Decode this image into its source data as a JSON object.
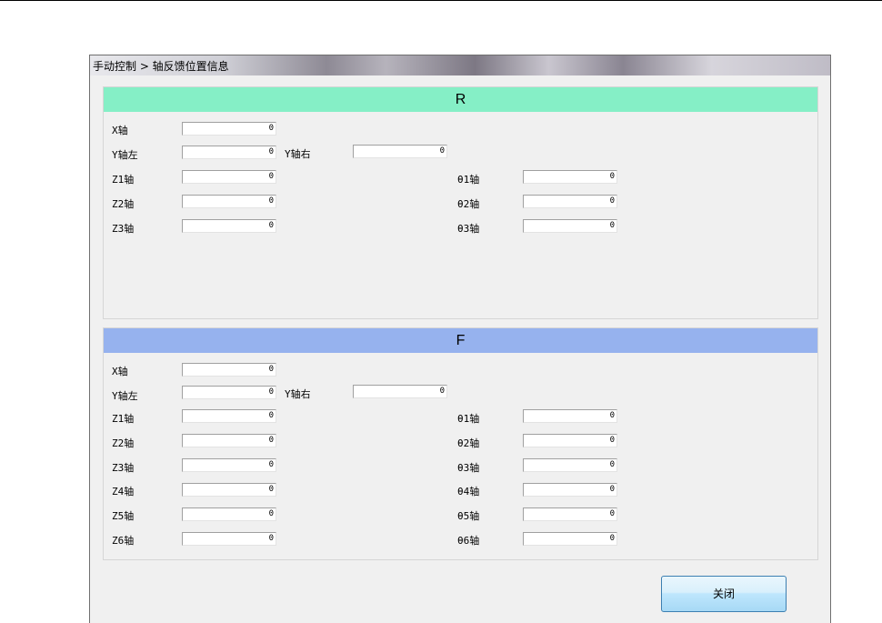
{
  "window": {
    "title": "手动控制 > 轴反馈位置信息"
  },
  "panel_r": {
    "header": "R",
    "x_label": "X轴",
    "x_value": "0",
    "y_left_label": "Y轴左",
    "y_left_value": "0",
    "y_right_label": "Y轴右",
    "y_right_value": "0",
    "rows": [
      {
        "z_label": "Z1轴",
        "z_value": "0",
        "t_label": "θ1轴",
        "t_value": "0"
      },
      {
        "z_label": "Z2轴",
        "z_value": "0",
        "t_label": "θ2轴",
        "t_value": "0"
      },
      {
        "z_label": "Z3轴",
        "z_value": "0",
        "t_label": "θ3轴",
        "t_value": "0"
      }
    ]
  },
  "panel_f": {
    "header": "F",
    "x_label": "X轴",
    "x_value": "0",
    "y_left_label": "Y轴左",
    "y_left_value": "0",
    "y_right_label": "Y轴右",
    "y_right_value": "0",
    "rows": [
      {
        "z_label": "Z1轴",
        "z_value": "0",
        "t_label": "θ1轴",
        "t_value": "0"
      },
      {
        "z_label": "Z2轴",
        "z_value": "0",
        "t_label": "θ2轴",
        "t_value": "0"
      },
      {
        "z_label": "Z3轴",
        "z_value": "0",
        "t_label": "θ3轴",
        "t_value": "0"
      },
      {
        "z_label": "Z4轴",
        "z_value": "0",
        "t_label": "θ4轴",
        "t_value": "0"
      },
      {
        "z_label": "Z5轴",
        "z_value": "0",
        "t_label": "θ5轴",
        "t_value": "0"
      },
      {
        "z_label": "Z6轴",
        "z_value": "0",
        "t_label": "θ6轴",
        "t_value": "0"
      }
    ]
  },
  "buttons": {
    "close_label": "关闭"
  },
  "colors": {
    "r_header": "#85efc6",
    "f_header": "#96b2ee"
  }
}
